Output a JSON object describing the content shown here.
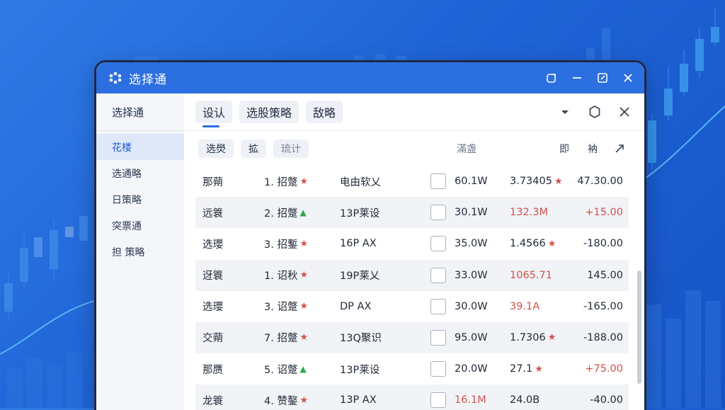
{
  "window": {
    "title": "选择通",
    "logo": "app-logo-icon"
  },
  "window_controls": [
    "restore-icon",
    "minimize-icon",
    "maximize-icon",
    "close-icon"
  ],
  "sidebar": {
    "header": "选择通",
    "items": [
      {
        "label": "花楼",
        "active": true
      },
      {
        "label": "选通略",
        "active": false
      },
      {
        "label": "日策略",
        "active": false
      },
      {
        "label": "突票通",
        "active": false
      },
      {
        "label": "担 策略",
        "active": false
      }
    ]
  },
  "tabs": [
    {
      "label": "设认",
      "active": true
    },
    {
      "label": "选股策略",
      "active": false
    },
    {
      "label": "敌略",
      "active": false
    }
  ],
  "toolbar_icons": [
    "dropdown-icon",
    "settings-icon",
    "close-icon"
  ],
  "filters": {
    "chips": [
      "选燢",
      "拡",
      "琉计"
    ],
    "label": "滿盏",
    "col1": "即",
    "col2": "衲",
    "expand_icon": "expand-icon"
  },
  "rows": [
    {
      "name": "那蒴",
      "strategy": "1. 招蹩",
      "marker": "star",
      "desc": "电由软乂",
      "volume": "60.1W",
      "price": "3.73405",
      "price_star": true,
      "price_red": false,
      "change": "47.30.00",
      "change_red": false
    },
    {
      "name": "远簑",
      "strategy": "2. 招蹩",
      "marker": "tri",
      "desc": "13P莱设",
      "volume": "30.1W",
      "price": "132.3M",
      "price_star": false,
      "price_red": true,
      "change": "+15.00",
      "change_red": true
    },
    {
      "name": "选瓔",
      "strategy": "3. 招鏨",
      "marker": "star",
      "desc": "16P AX",
      "volume": "35.0W",
      "price": "1.4566",
      "price_star": true,
      "price_red": false,
      "change": "-180.00",
      "change_red": false
    },
    {
      "name": "迓簑",
      "strategy": "1. 诏秋",
      "marker": "star",
      "desc": "19P莱乂",
      "volume": "33.0W",
      "price": "1065.71",
      "price_star": false,
      "price_red": true,
      "change": "145.00",
      "change_red": false
    },
    {
      "name": "选瓔",
      "strategy": "3. 诏蹩",
      "marker": "star",
      "desc": "DP AX",
      "volume": "30.0W",
      "price": "39.1A",
      "price_star": false,
      "price_red": true,
      "change": "-165.00",
      "change_red": false
    },
    {
      "name": "交蒴",
      "strategy": "7. 招蹩",
      "marker": "star",
      "desc": "13Q聚识",
      "volume": "95.0W",
      "price": "1.7306",
      "price_star": true,
      "price_red": false,
      "change": "-188.00",
      "change_red": false
    },
    {
      "name": "那赝",
      "strategy": "5. 诏蹩",
      "marker": "tri",
      "desc": "13P莱设",
      "volume": "20.0W",
      "price": "27.1",
      "price_star": true,
      "price_red": false,
      "change": "+75.00",
      "change_red": true
    },
    {
      "name": "龙簑",
      "strategy": "4. 赞鏊",
      "marker": "star",
      "desc": "13P AX",
      "volume": "16.1M",
      "volume_red": true,
      "price": "24.0B",
      "price_star": false,
      "price_red": false,
      "change": "-40.00",
      "change_red": false
    }
  ],
  "colors": {
    "titlebar": "#2c6fe0",
    "background": "#1f63d6",
    "up": "#2cab49",
    "down": "#d2524b"
  }
}
